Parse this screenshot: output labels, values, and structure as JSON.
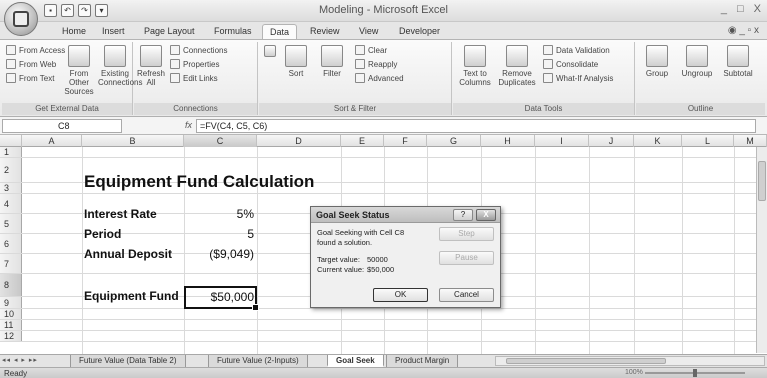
{
  "window": {
    "title": "Modeling - Microsoft Excel",
    "controls": [
      "_",
      "□",
      "X"
    ]
  },
  "qat": [
    "save-icon",
    "undo-icon",
    "redo-icon",
    "dropdown-icon"
  ],
  "tabs": [
    "Home",
    "Insert",
    "Page Layout",
    "Formulas",
    "Data",
    "Review",
    "View",
    "Developer"
  ],
  "active_tab": "Data",
  "ribbon": {
    "external_data": {
      "label": "Get External Data",
      "from_access": "From Access",
      "from_web": "From Web",
      "from_text": "From Text",
      "from_other": "From Other Sources",
      "existing": "Existing Connections"
    },
    "connections": {
      "label": "Connections",
      "refresh": "Refresh All",
      "connections": "Connections",
      "properties": "Properties",
      "edit_links": "Edit Links"
    },
    "sort_filter": {
      "label": "Sort & Filter",
      "sort": "Sort",
      "filter": "Filter",
      "clear": "Clear",
      "reapply": "Reapply",
      "advanced": "Advanced"
    },
    "data_tools": {
      "label": "Data Tools",
      "text_to_columns": "Text to Columns",
      "remove_duplicates": "Remove Duplicates",
      "data_validation": "Data Validation",
      "consolidate": "Consolidate",
      "what_if": "What-If Analysis"
    },
    "outline": {
      "label": "Outline",
      "group": "Group",
      "ungroup": "Ungroup",
      "subtotal": "Subtotal"
    }
  },
  "formula_bar": {
    "name_box": "C8",
    "fx": "fx",
    "formula": "=FV(C4, C5, C6)"
  },
  "columns": [
    "A",
    "B",
    "C",
    "D",
    "E",
    "F",
    "G",
    "H",
    "I",
    "J",
    "K",
    "L",
    "M"
  ],
  "rows": [
    "1",
    "2",
    "3",
    "4",
    "5",
    "6",
    "7",
    "8",
    "9",
    "10",
    "11",
    "12"
  ],
  "sheet": {
    "title": "Equipment Fund Calculation",
    "interest_label": "Interest Rate",
    "interest_value": "5%",
    "period_label": "Period",
    "period_value": "5",
    "deposit_label": "Annual Deposit",
    "deposit_value": "($9,049)",
    "fund_label": "Equipment Fund",
    "fund_value": "$50,000"
  },
  "dialog": {
    "title": "Goal Seek Status",
    "help": "?",
    "close": "X",
    "line1": "Goal Seeking with Cell C8",
    "line2": "found a solution.",
    "target_label": "Target value:",
    "target_value": "50000",
    "current_label": "Current value:",
    "current_value": "$50,000",
    "step": "Step",
    "pause": "Pause",
    "ok": "OK",
    "cancel": "Cancel"
  },
  "sheet_tabs": [
    "Future Value (Data Table 2)",
    "Future Value (2-Inputs)",
    "Goal Seek",
    "Product Margin"
  ],
  "active_sheet": "Goal Seek",
  "status": {
    "ready": "Ready",
    "zoom": "100%"
  }
}
